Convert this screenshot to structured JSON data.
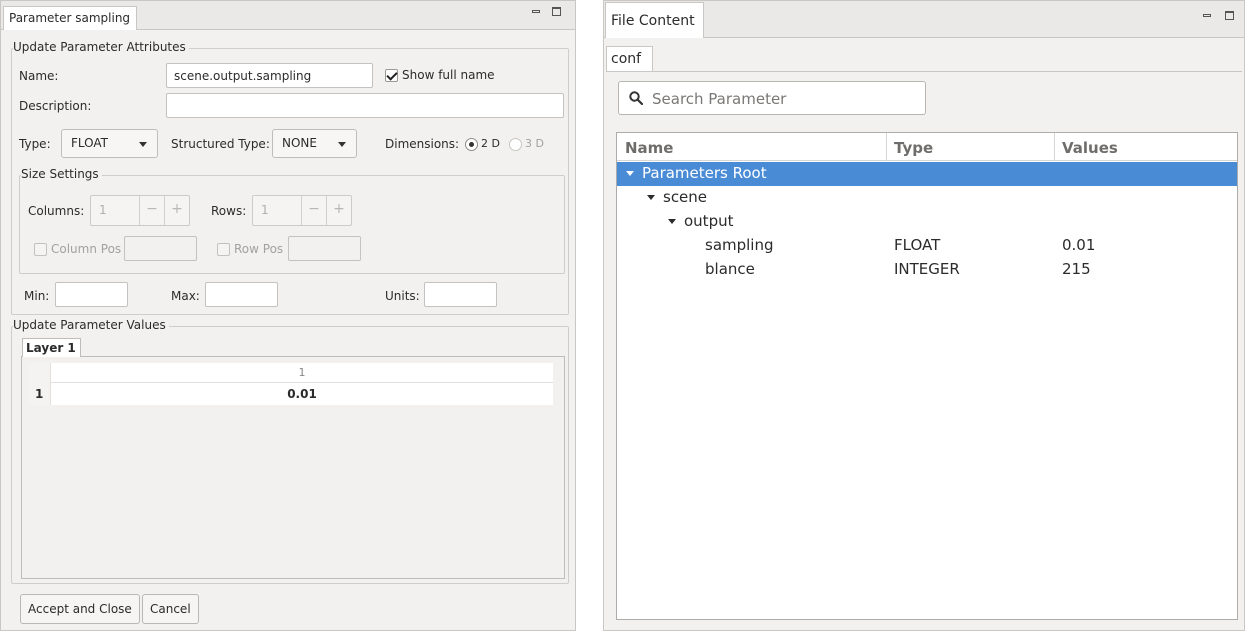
{
  "left_view": {
    "tab_label": "Parameter sampling",
    "attributes_group": "Update Parameter Attributes",
    "name_label": "Name:",
    "name_value": "scene.output.sampling",
    "show_full_name_label": "Show full name",
    "show_full_name_checked": true,
    "description_label": "Description:",
    "description_value": "",
    "type_label": "Type:",
    "type_value": "FLOAT",
    "structured_type_label": "Structured Type:",
    "structured_type_value": "NONE",
    "dimensions_label": "Dimensions:",
    "dim_2d_label": "2 D",
    "dim_3d_label": "3 D",
    "dimension_selected": "2 D",
    "size_group": "Size Settings",
    "columns_label": "Columns:",
    "columns_value": "1",
    "rows_label": "Rows:",
    "rows_value": "1",
    "minus_glyph": "−",
    "plus_glyph": "+",
    "column_pos_label": "Column Pos",
    "row_pos_label": "Row Pos",
    "min_label": "Min:",
    "max_label": "Max:",
    "units_label": "Units:",
    "values_group": "Update Parameter Values",
    "layer_tab": "Layer 1",
    "table": {
      "column_headers": [
        "1"
      ],
      "rows": [
        {
          "header": "1",
          "cells": [
            "0.01"
          ]
        }
      ]
    },
    "accept_button": "Accept and Close",
    "cancel_button": "Cancel"
  },
  "right_view": {
    "tab_label": "File Content",
    "file_tab": "conf",
    "search_placeholder": "Search Parameter",
    "columns": [
      "Name",
      "Type",
      "Values"
    ],
    "tree": [
      {
        "name": "Parameters Root",
        "type": "",
        "value": "",
        "selected": true
      },
      {
        "name": "scene",
        "type": "",
        "value": ""
      },
      {
        "name": "output",
        "type": "",
        "value": ""
      },
      {
        "name": "sampling",
        "type": "FLOAT",
        "value": "0.01"
      },
      {
        "name": "blance",
        "type": "INTEGER",
        "value": "215"
      }
    ]
  },
  "colors": {
    "selection": "#4a8bd6",
    "panel_bg": "#f2f1f0"
  }
}
